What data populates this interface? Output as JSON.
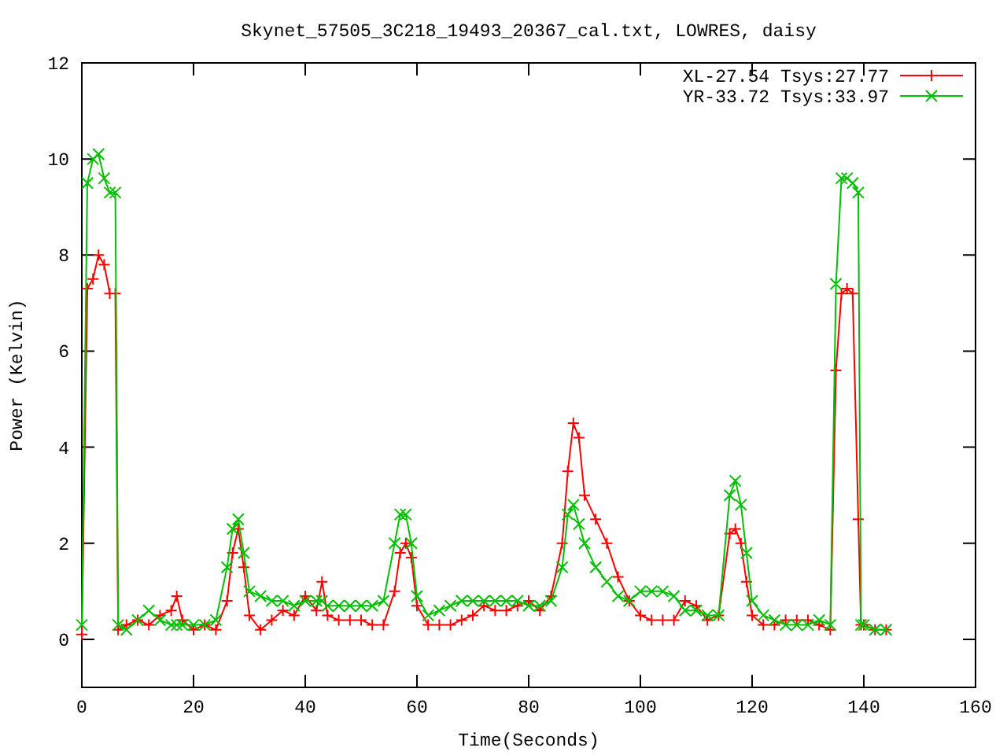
{
  "chart_data": {
    "type": "line",
    "title": "Skynet_57505_3C218_19493_20367_cal.txt, LOWRES, daisy",
    "xlabel": "Time(Seconds)",
    "ylabel": "Power (Kelvin)",
    "x": [
      0,
      1,
      2,
      3,
      4,
      5,
      6,
      6.5,
      8,
      10,
      12,
      14,
      16,
      17,
      18,
      20,
      22,
      24,
      26,
      27,
      28,
      29,
      30,
      32,
      34,
      36,
      38,
      40,
      42,
      43,
      44,
      46,
      48,
      50,
      52,
      54,
      56,
      57,
      58,
      59,
      60,
      62,
      64,
      66,
      68,
      70,
      72,
      74,
      76,
      78,
      80,
      82,
      84,
      86,
      87,
      88,
      89,
      90,
      92,
      94,
      96,
      98,
      100,
      102,
      104,
      106,
      108,
      110,
      112,
      114,
      116,
      117,
      118,
      119,
      120,
      122,
      124,
      126,
      128,
      130,
      132,
      134,
      135,
      136,
      137,
      138,
      139,
      139.5,
      140,
      142,
      144
    ],
    "series": [
      {
        "name": "XL-27.54 Tsys:27.77",
        "color": "#ff0000",
        "marker": "plus",
        "values": [
          0.1,
          7.3,
          7.5,
          8.0,
          7.8,
          7.2,
          7.2,
          0.2,
          0.3,
          0.4,
          0.3,
          0.5,
          0.6,
          0.9,
          0.4,
          0.2,
          0.3,
          0.2,
          0.8,
          1.8,
          2.3,
          1.5,
          0.5,
          0.2,
          0.4,
          0.6,
          0.5,
          0.9,
          0.6,
          1.2,
          0.5,
          0.4,
          0.4,
          0.4,
          0.3,
          0.3,
          1.0,
          1.8,
          2.0,
          1.7,
          0.7,
          0.3,
          0.3,
          0.3,
          0.4,
          0.5,
          0.7,
          0.6,
          0.6,
          0.7,
          0.8,
          0.6,
          0.9,
          2.0,
          3.5,
          4.5,
          4.2,
          3.0,
          2.5,
          2.0,
          1.3,
          0.8,
          0.5,
          0.4,
          0.4,
          0.4,
          0.8,
          0.7,
          0.4,
          0.5,
          2.2,
          2.3,
          2.0,
          1.2,
          0.5,
          0.3,
          0.3,
          0.4,
          0.4,
          0.4,
          0.3,
          0.2,
          5.6,
          7.2,
          7.3,
          7.2,
          2.5,
          0.3,
          0.3,
          0.2,
          0.2
        ]
      },
      {
        "name": "YR-33.72 Tsys:33.97",
        "color": "#00c000",
        "marker": "cross",
        "values": [
          0.3,
          9.5,
          10.0,
          10.1,
          9.6,
          9.3,
          9.3,
          0.3,
          0.2,
          0.4,
          0.6,
          0.4,
          0.3,
          0.3,
          0.3,
          0.3,
          0.3,
          0.4,
          1.5,
          2.3,
          2.5,
          1.8,
          1.0,
          0.9,
          0.8,
          0.8,
          0.7,
          0.8,
          0.8,
          0.8,
          0.7,
          0.7,
          0.7,
          0.7,
          0.7,
          0.8,
          2.0,
          2.6,
          2.6,
          2.0,
          0.9,
          0.5,
          0.6,
          0.7,
          0.8,
          0.8,
          0.8,
          0.8,
          0.8,
          0.8,
          0.7,
          0.7,
          0.8,
          1.5,
          2.6,
          2.8,
          2.4,
          2.0,
          1.5,
          1.2,
          0.9,
          0.8,
          1.0,
          1.0,
          1.0,
          0.9,
          0.6,
          0.6,
          0.5,
          0.5,
          3.0,
          3.3,
          2.8,
          1.8,
          0.8,
          0.5,
          0.4,
          0.3,
          0.3,
          0.3,
          0.4,
          0.3,
          7.4,
          9.6,
          9.6,
          9.5,
          9.3,
          0.3,
          0.3,
          0.2,
          0.2
        ]
      }
    ],
    "legend": true,
    "xlim": [
      0,
      160
    ],
    "ylim": [
      -1,
      12
    ],
    "xticks": [
      0,
      20,
      40,
      60,
      80,
      100,
      120,
      140,
      160
    ],
    "yticks": [
      0,
      2,
      4,
      6,
      8,
      10,
      12
    ]
  }
}
